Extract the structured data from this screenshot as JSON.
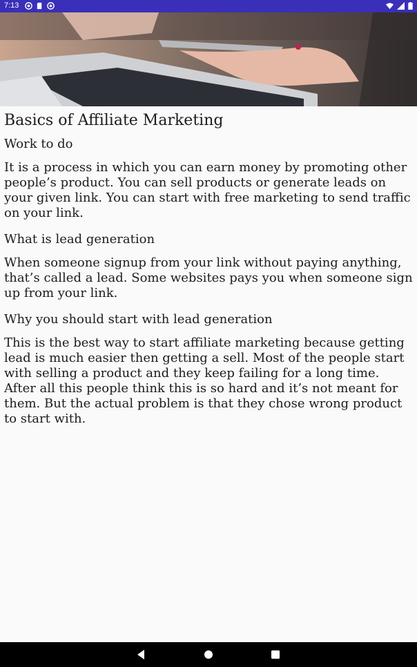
{
  "status_bar": {
    "time": "7:13",
    "left_icons": [
      "sync-icon",
      "sd-card-icon",
      "sync-icon"
    ],
    "right_icons": [
      "wifi-icon",
      "signal-icon",
      "battery-icon"
    ],
    "background": "#3a2fb8"
  },
  "hero": {
    "icon": "laptop-phone-photo"
  },
  "article": {
    "title": "Basics of Affiliate Marketing",
    "sections": [
      {
        "heading": "Work to do",
        "body": "It is a process in which you can earn money by promoting other people’s product. You can sell products or generate leads on your given link. You can start with free marketing to send traffic on your link."
      },
      {
        "heading": "What is lead generation",
        "body": "When someone signup from your link without paying anything, that’s called a lead. Some websites pays you when someone sign up from your link."
      },
      {
        "heading": "Why you should start with lead generation",
        "body": "This is the best way to start affiliate marketing because getting lead is much easier then getting a sell. Most of the people start with selling a product and they keep failing for a long time. After all this people think this is so hard and it’s not meant for them. But the actual problem is that they chose wrong product to start with."
      }
    ]
  },
  "nav_bar": {
    "buttons": [
      "back-icon",
      "home-icon",
      "recents-icon"
    ]
  }
}
